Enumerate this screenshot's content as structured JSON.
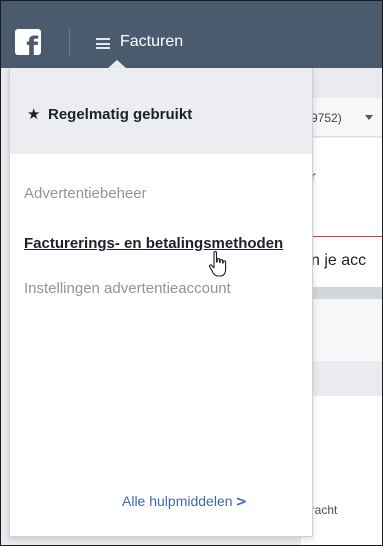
{
  "topbar": {
    "logo_letter": "f",
    "menu_title": "Facturen"
  },
  "background": {
    "account_id_fragment": "9752)",
    "panel_fragment": "r",
    "alert_fragment": "n je acc",
    "footer_fragment": "pracht",
    "alert_border_color": "#d93b3b"
  },
  "dropdown": {
    "header_label": "Regelmatig gebruikt",
    "items": [
      {
        "label": "Advertentiebeheer"
      },
      {
        "label": "Facturerings- en betalingsmethoden"
      },
      {
        "label": "Instellingen advertentieaccount"
      }
    ],
    "all_tools_label": "Alle hulpmiddelen",
    "link_color": "#4267b2"
  },
  "icons": {
    "logo": "facebook-logo-icon",
    "menu": "hamburger-menu-icon",
    "star": "star-icon",
    "cursor": "hand-pointer-cursor-icon",
    "chevron": "chevron-right-icon"
  },
  "colors": {
    "topbar": "#4a5b6d",
    "header_bg": "#ebedf0"
  }
}
